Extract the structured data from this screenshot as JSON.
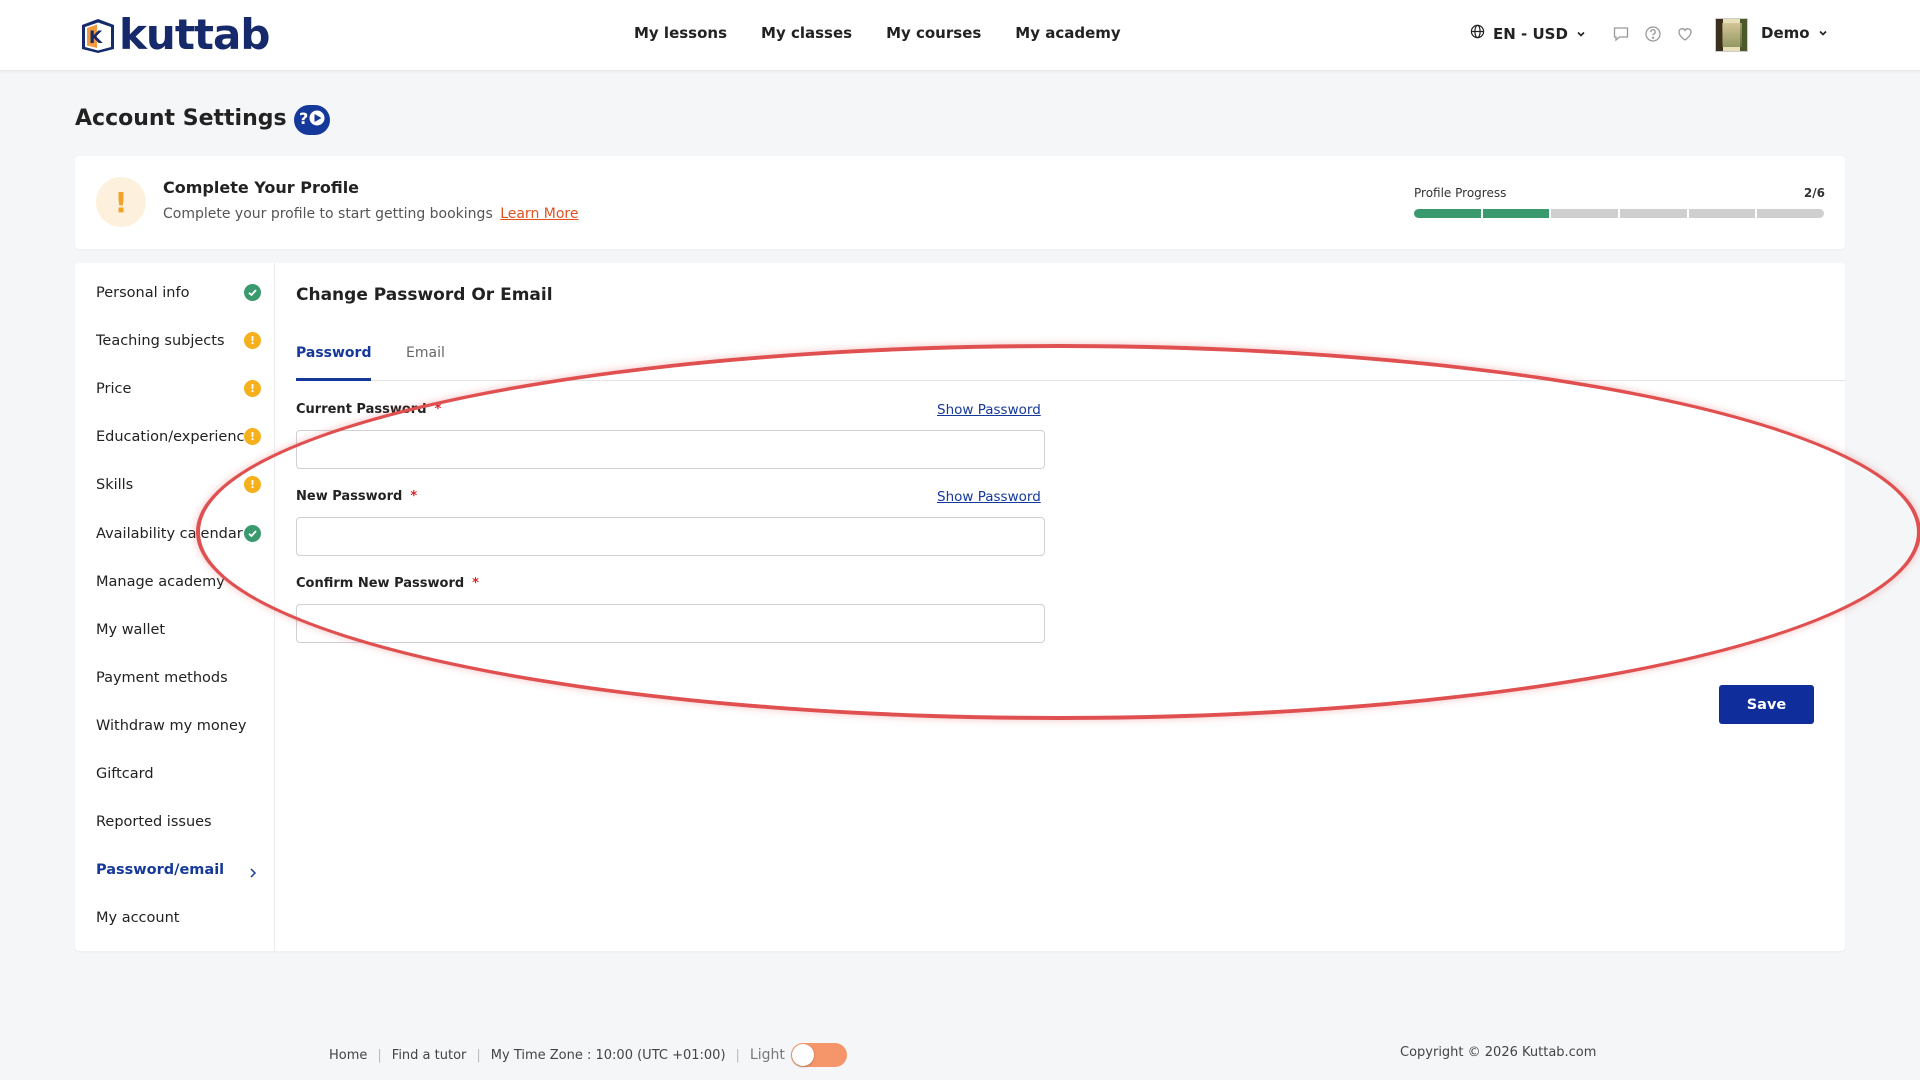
{
  "header": {
    "logo_text": "kuttab",
    "nav": [
      "My lessons",
      "My classes",
      "My courses",
      "My academy"
    ],
    "language_currency": "EN - USD",
    "user_name": "Demo"
  },
  "page": {
    "title": "Account Settings"
  },
  "profile_card": {
    "title": "Complete Your Profile",
    "subtitle": "Complete your profile to start getting bookings",
    "learn_more": "Learn More",
    "progress_label": "Profile Progress",
    "progress_text": "2/6",
    "progress_done": 2,
    "progress_total": 6
  },
  "sidebar": {
    "items": [
      {
        "label": "Personal info",
        "status": "ok"
      },
      {
        "label": "Teaching subjects",
        "status": "warn"
      },
      {
        "label": "Price",
        "status": "warn"
      },
      {
        "label": "Education/experience",
        "status": "warn"
      },
      {
        "label": "Skills",
        "status": "warn"
      },
      {
        "label": "Availability calendar",
        "status": "ok"
      },
      {
        "label": "Manage academy",
        "status": "none"
      },
      {
        "label": "My wallet",
        "status": "none"
      },
      {
        "label": "Payment methods",
        "status": "none"
      },
      {
        "label": "Withdraw my money",
        "status": "none"
      },
      {
        "label": "Giftcard",
        "status": "none"
      },
      {
        "label": "Reported issues",
        "status": "none"
      },
      {
        "label": "Password/email",
        "status": "active"
      },
      {
        "label": "My account",
        "status": "none"
      }
    ]
  },
  "content": {
    "title": "Change Password Or Email",
    "tabs": [
      "Password",
      "Email"
    ],
    "active_tab": "Password",
    "fields": [
      {
        "label": "Current Password",
        "required": "*",
        "show_link": "Show Password",
        "value": ""
      },
      {
        "label": "New Password",
        "required": "*",
        "show_link": "Show Password",
        "value": ""
      },
      {
        "label": "Confirm New Password",
        "required": "*",
        "value": ""
      }
    ],
    "save_label": "Save"
  },
  "footer": {
    "links": [
      "Home",
      "Find a tutor"
    ],
    "timezone": "My Time Zone : 10:00 (UTC +01:00)",
    "theme_label": "Light",
    "copyright": "Copyright © 2026 Kuttab.com"
  },
  "colors": {
    "brand": "#15399a",
    "success": "#3a9a6e",
    "warning": "#f5b01c",
    "accent": "#e0531f",
    "annotation": "#e05050"
  },
  "icons": [
    "globe-icon",
    "chevron-down-icon",
    "chat-icon",
    "help-icon",
    "heart-icon",
    "help-play-icon",
    "check-icon",
    "exclamation-icon",
    "chevron-right-icon"
  ]
}
